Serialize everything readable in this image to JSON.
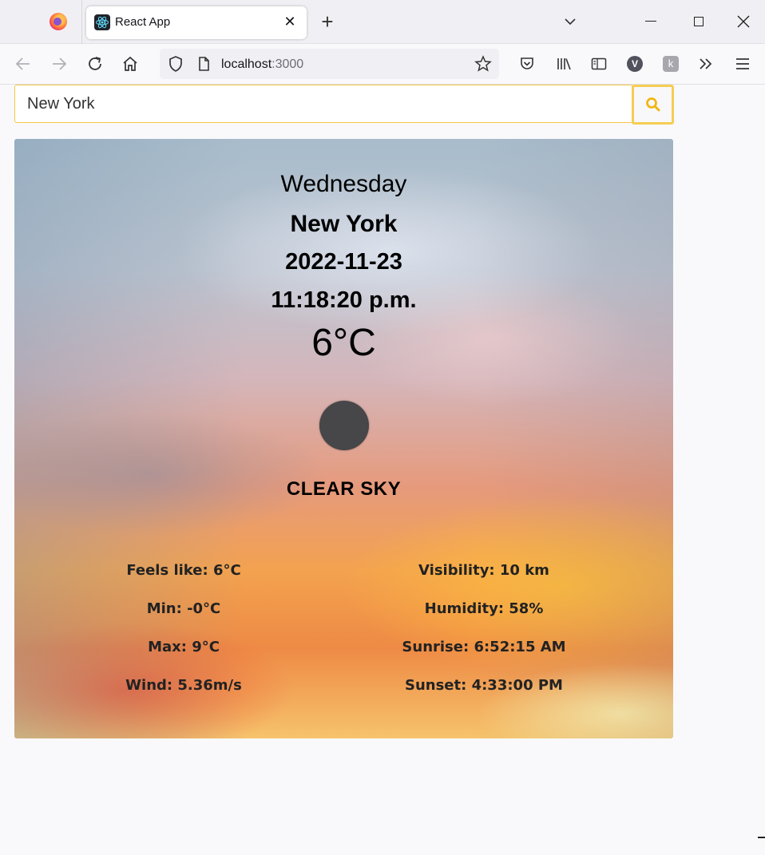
{
  "browser": {
    "tab_title": "React App",
    "tab_close": "✕",
    "new_tab": "+",
    "url_host": "localhost",
    "url_port": ":3000",
    "profile_initial": "V",
    "extension_glyph": "k"
  },
  "search": {
    "value": "New York"
  },
  "weather": {
    "day": "Wednesday",
    "city": "New York",
    "date": "2022-11-23",
    "time": "11:18:20 p.m.",
    "temperature": "6°C",
    "description": "CLEAR SKY",
    "icon": "weather-icon"
  },
  "details": {
    "left": [
      "Feels like: 6°C",
      "Min: -0°C",
      "Max: 9°C",
      "Wind: 5.36m/s"
    ],
    "right": [
      "Visibility: 10 km",
      "Humidity: 58%",
      "Sunrise: 6:52:15 AM",
      "Sunset: 4:33:00 PM"
    ]
  },
  "colors": {
    "accent": "#f5c64a",
    "icon_fill": "#474649"
  }
}
